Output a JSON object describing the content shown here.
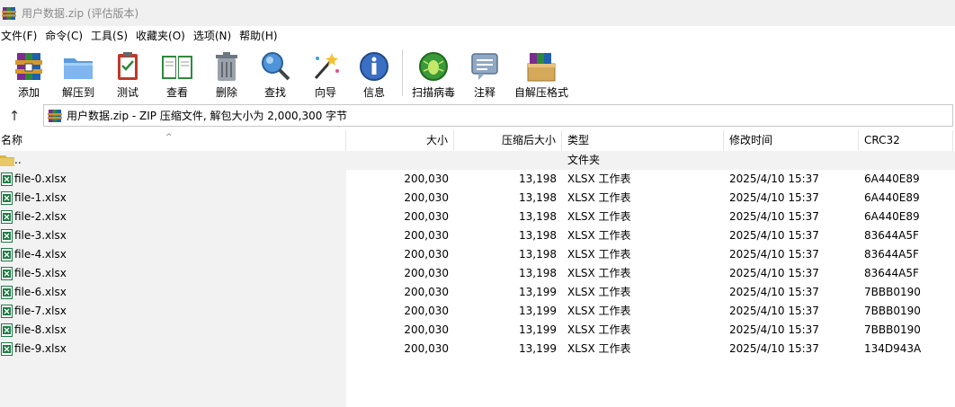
{
  "window": {
    "title": "用户数据.zip (评估版本)"
  },
  "menu": [
    "文件(F)",
    "命令(C)",
    "工具(S)",
    "收藏夹(O)",
    "选项(N)",
    "帮助(H)"
  ],
  "toolbar": [
    {
      "label": "添加",
      "icon": "add-archive-icon"
    },
    {
      "label": "解压到",
      "icon": "extract-to-folder-icon"
    },
    {
      "label": "测试",
      "icon": "test-clipboard-icon"
    },
    {
      "label": "查看",
      "icon": "view-book-icon"
    },
    {
      "label": "删除",
      "icon": "delete-trash-icon"
    },
    {
      "label": "查找",
      "icon": "find-magnifier-icon"
    },
    {
      "label": "向导",
      "icon": "wizard-wand-icon"
    },
    {
      "label": "信息",
      "icon": "info-icon"
    },
    {
      "label": "扫描病毒",
      "icon": "virus-scan-icon"
    },
    {
      "label": "注释",
      "icon": "comment-icon"
    },
    {
      "label": "自解压格式",
      "icon": "sfx-box-icon"
    }
  ],
  "address": {
    "text": "用户数据.zip - ZIP 压缩文件, 解包大小为 2,000,300 字节"
  },
  "columns": {
    "name": "名称",
    "size": "大小",
    "packed": "压缩后大小",
    "type": "类型",
    "modified": "修改时间",
    "crc": "CRC32"
  },
  "parent_row": {
    "name": "..",
    "type": "文件夹"
  },
  "files": [
    {
      "name": "file-0.xlsx",
      "size": "200,030",
      "packed": "13,198",
      "type": "XLSX 工作表",
      "modified": "2025/4/10 15:37",
      "crc": "6A440E89"
    },
    {
      "name": "file-1.xlsx",
      "size": "200,030",
      "packed": "13,198",
      "type": "XLSX 工作表",
      "modified": "2025/4/10 15:37",
      "crc": "6A440E89"
    },
    {
      "name": "file-2.xlsx",
      "size": "200,030",
      "packed": "13,198",
      "type": "XLSX 工作表",
      "modified": "2025/4/10 15:37",
      "crc": "6A440E89"
    },
    {
      "name": "file-3.xlsx",
      "size": "200,030",
      "packed": "13,198",
      "type": "XLSX 工作表",
      "modified": "2025/4/10 15:37",
      "crc": "83644A5F"
    },
    {
      "name": "file-4.xlsx",
      "size": "200,030",
      "packed": "13,198",
      "type": "XLSX 工作表",
      "modified": "2025/4/10 15:37",
      "crc": "83644A5F"
    },
    {
      "name": "file-5.xlsx",
      "size": "200,030",
      "packed": "13,198",
      "type": "XLSX 工作表",
      "modified": "2025/4/10 15:37",
      "crc": "83644A5F"
    },
    {
      "name": "file-6.xlsx",
      "size": "200,030",
      "packed": "13,199",
      "type": "XLSX 工作表",
      "modified": "2025/4/10 15:37",
      "crc": "7BBB0190"
    },
    {
      "name": "file-7.xlsx",
      "size": "200,030",
      "packed": "13,199",
      "type": "XLSX 工作表",
      "modified": "2025/4/10 15:37",
      "crc": "7BBB0190"
    },
    {
      "name": "file-8.xlsx",
      "size": "200,030",
      "packed": "13,199",
      "type": "XLSX 工作表",
      "modified": "2025/4/10 15:37",
      "crc": "7BBB0190"
    },
    {
      "name": "file-9.xlsx",
      "size": "200,030",
      "packed": "13,199",
      "type": "XLSX 工作表",
      "modified": "2025/4/10 15:37",
      "crc": "134D943A"
    }
  ]
}
